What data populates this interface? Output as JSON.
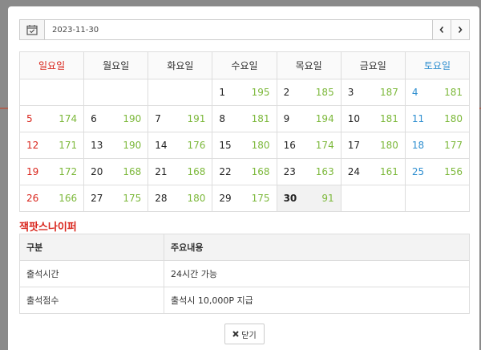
{
  "datebar": {
    "date_value": "2023-11-30"
  },
  "weekdays": [
    "일요일",
    "월요일",
    "화요일",
    "수요일",
    "목요일",
    "금요일",
    "토요일"
  ],
  "calendar": {
    "weeks": [
      [
        {
          "d": "",
          "c": ""
        },
        {
          "d": "",
          "c": ""
        },
        {
          "d": "",
          "c": ""
        },
        {
          "d": "1",
          "c": "195"
        },
        {
          "d": "2",
          "c": "185"
        },
        {
          "d": "3",
          "c": "187"
        },
        {
          "d": "4",
          "c": "181"
        }
      ],
      [
        {
          "d": "5",
          "c": "174"
        },
        {
          "d": "6",
          "c": "190"
        },
        {
          "d": "7",
          "c": "191"
        },
        {
          "d": "8",
          "c": "181"
        },
        {
          "d": "9",
          "c": "194"
        },
        {
          "d": "10",
          "c": "181"
        },
        {
          "d": "11",
          "c": "180"
        }
      ],
      [
        {
          "d": "12",
          "c": "171"
        },
        {
          "d": "13",
          "c": "190"
        },
        {
          "d": "14",
          "c": "176"
        },
        {
          "d": "15",
          "c": "180"
        },
        {
          "d": "16",
          "c": "174"
        },
        {
          "d": "17",
          "c": "180"
        },
        {
          "d": "18",
          "c": "177"
        }
      ],
      [
        {
          "d": "19",
          "c": "172"
        },
        {
          "d": "20",
          "c": "168"
        },
        {
          "d": "21",
          "c": "168"
        },
        {
          "d": "22",
          "c": "168"
        },
        {
          "d": "23",
          "c": "163"
        },
        {
          "d": "24",
          "c": "161"
        },
        {
          "d": "25",
          "c": "156"
        }
      ],
      [
        {
          "d": "26",
          "c": "166"
        },
        {
          "d": "27",
          "c": "175"
        },
        {
          "d": "28",
          "c": "180"
        },
        {
          "d": "29",
          "c": "175"
        },
        {
          "d": "30",
          "c": "91"
        },
        {
          "d": "",
          "c": ""
        },
        {
          "d": "",
          "c": ""
        }
      ]
    ],
    "today": "30"
  },
  "section": {
    "title": "잭팟스나이퍼"
  },
  "info_table": {
    "headers": [
      "구분",
      "주요내용"
    ],
    "rows": [
      [
        "출석시간",
        "24시간 가능"
      ],
      [
        "출석점수",
        "출석시 10,000P 지급"
      ]
    ]
  },
  "close_label": "닫기",
  "colors": {
    "sunday": "#d9251c",
    "saturday": "#2f8fd0",
    "count": "#7cb83a"
  },
  "icons": {
    "calendar": "calendar-check-icon",
    "prev": "chevron-left-icon",
    "next": "chevron-right-icon",
    "close": "close-icon"
  }
}
